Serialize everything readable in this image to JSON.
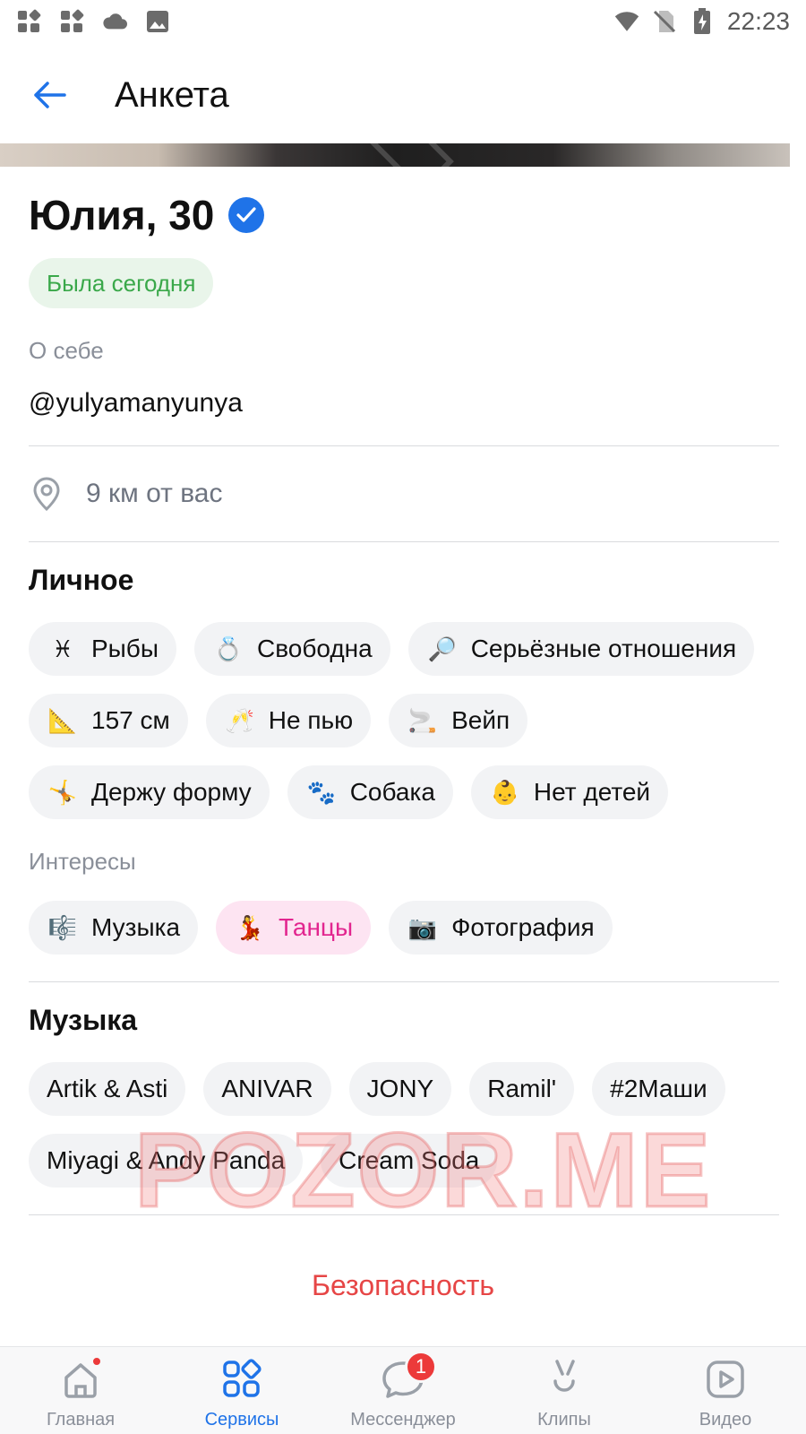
{
  "statusbar": {
    "time": "22:23"
  },
  "header": {
    "title": "Анкета"
  },
  "profile": {
    "name_age": "Юлия, 30",
    "online_status": "Была сегодня",
    "about_label": "О себе",
    "about_text": "@yulyamanyunya",
    "distance": "9 км от вас"
  },
  "personal": {
    "title": "Личное",
    "rows": [
      [
        {
          "emoji": "♓",
          "label": "Рыбы"
        },
        {
          "emoji": "💍",
          "label": "Свободна"
        },
        {
          "emoji": "🔎",
          "label": "Серьёзные отношения"
        }
      ],
      [
        {
          "emoji": "📐",
          "label": "157 см"
        },
        {
          "emoji": "🥂",
          "label": "Не пью"
        },
        {
          "emoji": "🚬",
          "label": "Вейп"
        }
      ],
      [
        {
          "emoji": "🤸",
          "label": "Держу форму"
        },
        {
          "emoji": "🐾",
          "label": "Собака"
        },
        {
          "emoji": "👶",
          "label": "Нет детей"
        }
      ]
    ]
  },
  "interests": {
    "label": "Интересы",
    "items": [
      {
        "emoji": "🎼",
        "label": "Музыка"
      },
      {
        "emoji": "💃",
        "label": "Танцы"
      },
      {
        "emoji": "📷",
        "label": "Фотография"
      }
    ]
  },
  "music": {
    "title": "Музыка",
    "items": [
      "Artik & Asti",
      "ANIVAR",
      "JONY",
      "Ramil'",
      "#2Маши",
      "Miyagi & Andy Panda",
      "Cream Soda"
    ]
  },
  "safety": {
    "label": "Безопасность"
  },
  "watermark": "POZOR.ME",
  "bottomnav": {
    "items": [
      {
        "label": "Главная"
      },
      {
        "label": "Сервисы"
      },
      {
        "label": "Мессенджер",
        "badge": "1"
      },
      {
        "label": "Клипы"
      },
      {
        "label": "Видео"
      }
    ]
  },
  "colors": {
    "accent": "#1f73e8",
    "online_green": "#3aa84a",
    "danger": "#e64646",
    "dance_pink": "#e2258f"
  }
}
